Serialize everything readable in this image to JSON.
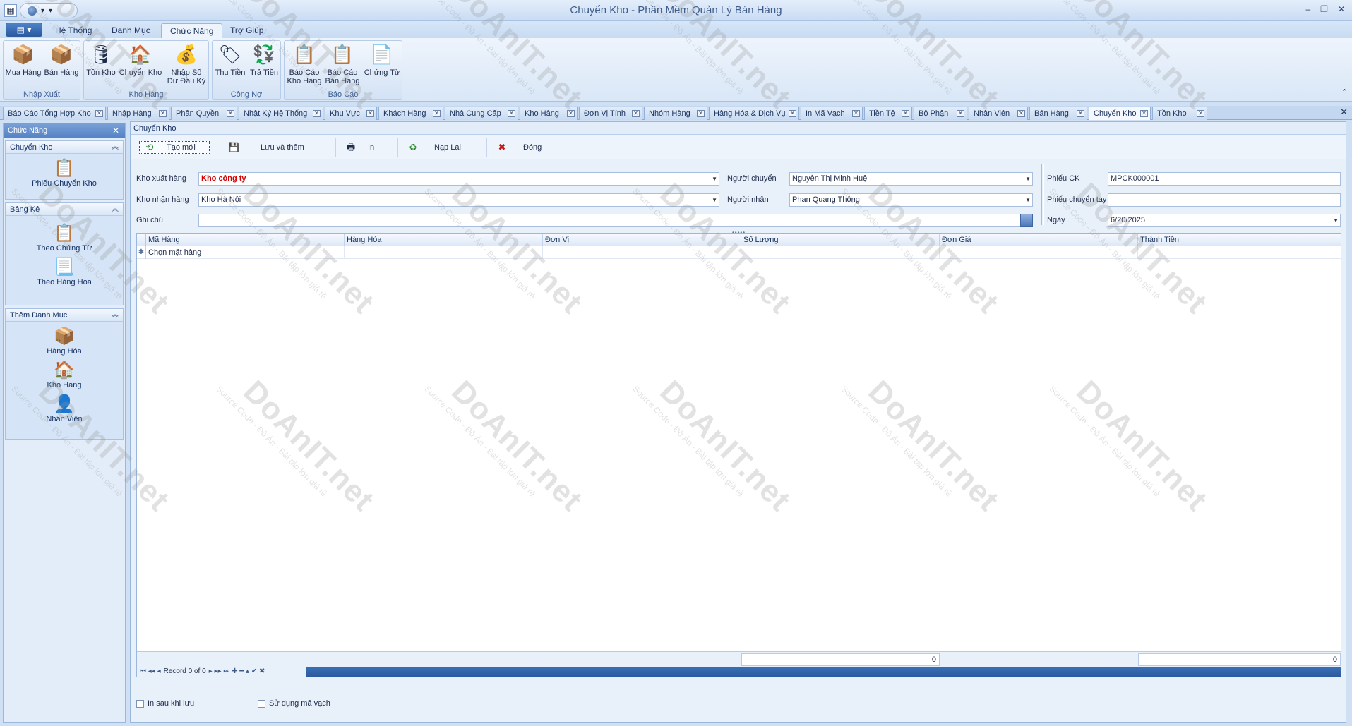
{
  "window": {
    "title": "Chuyển Kho - Phần Mềm Quản Lý Bán Hàng"
  },
  "ribbon": {
    "tabs": [
      "Hệ Thống",
      "Danh Mục",
      "Chức Năng",
      "Trợ Giúp"
    ],
    "active_tab": "Chức Năng",
    "groups": [
      {
        "label": "Nhập Xuất",
        "buttons": [
          "Mua Hàng",
          "Bán Hàng"
        ]
      },
      {
        "label": "Kho Hàng",
        "buttons": [
          "Tồn Kho",
          "Chuyển Kho",
          "Nhập Số\nDư Đầu Kỳ"
        ]
      },
      {
        "label": "Công Nợ",
        "buttons": [
          "Thu Tiền",
          "Trả Tiền"
        ]
      },
      {
        "label": "Báo Cáo",
        "buttons": [
          "Báo Cáo\nKho Hàng",
          "Báo Cáo\nBán Hàng",
          "Chứng Từ"
        ]
      }
    ]
  },
  "doc_tabs": [
    "Báo Cáo Tổng Hợp Kho",
    "Nhập Hàng",
    "Phân Quyền",
    "Nhật Ký Hệ Thống",
    "Khu Vực",
    "Khách Hàng",
    "Nhà Cung Cấp",
    "Kho Hàng",
    "Đơn Vị Tính",
    "Nhóm Hàng",
    "Hàng Hóa & Dịch Vụ",
    "In Mã Vạch",
    "Tiền Tệ",
    "Bộ Phận",
    "Nhân Viên",
    "Bán Hàng",
    "Chuyển Kho",
    "Tồn Kho"
  ],
  "active_doc_tab": "Chuyển Kho",
  "left_panel": {
    "header": "Chức Năng",
    "groups": [
      {
        "title": "Chuyển Kho",
        "items": [
          "Phiếu Chuyển Kho"
        ]
      },
      {
        "title": "Bảng Kê",
        "items": [
          "Theo Chứng Từ",
          "Theo Hàng Hóa"
        ]
      },
      {
        "title": "Thêm Danh Mục",
        "items": [
          "Hàng Hóa",
          "Kho Hàng",
          "Nhân Viên"
        ]
      }
    ]
  },
  "main": {
    "title": "Chuyển Kho",
    "toolbar": {
      "new": "Tạo mới",
      "save_add": "Lưu và thêm",
      "print": "In",
      "reload": "Nạp Lại",
      "close": "Đóng"
    },
    "form": {
      "kho_xuat_label": "Kho xuất hàng",
      "kho_xuat_value": "Kho công ty",
      "kho_nhan_label": "Kho nhận hàng",
      "kho_nhan_value": "Kho Hà Nội",
      "ghi_chu_label": "Ghi chú",
      "ghi_chu_value": "",
      "nguoi_chuyen_label": "Người chuyển",
      "nguoi_chuyen_value": "Nguyễn Thị Minh  Huệ",
      "nguoi_nhan_label": "Người nhận",
      "nguoi_nhan_value": "Phan Quang Thông",
      "phieu_ck_label": "Phiếu CK",
      "phieu_ck_value": "MPCK000001",
      "phieu_tay_label": "Phiếu chuyển tay",
      "phieu_tay_value": "",
      "ngay_label": "Ngày",
      "ngay_value": "6/20/2025"
    },
    "grid": {
      "columns": [
        "Mã Hàng",
        "Hàng Hóa",
        "Đơn Vị",
        "Số Lượng",
        "Đơn Giá",
        "Thành Tiền"
      ],
      "new_row_text": "Chọn mặt hàng",
      "sum_quantity": "0",
      "sum_total": "0",
      "navigator": "Record 0 of 0"
    },
    "options": {
      "print_after_save": "In sau khi lưu",
      "use_barcode": "Sử dụng mã vạch"
    }
  },
  "watermark": {
    "brand": "DoAnIT.net",
    "tagline": "Source Code - Đồ Án - Bài tập lớn giá rẻ"
  }
}
